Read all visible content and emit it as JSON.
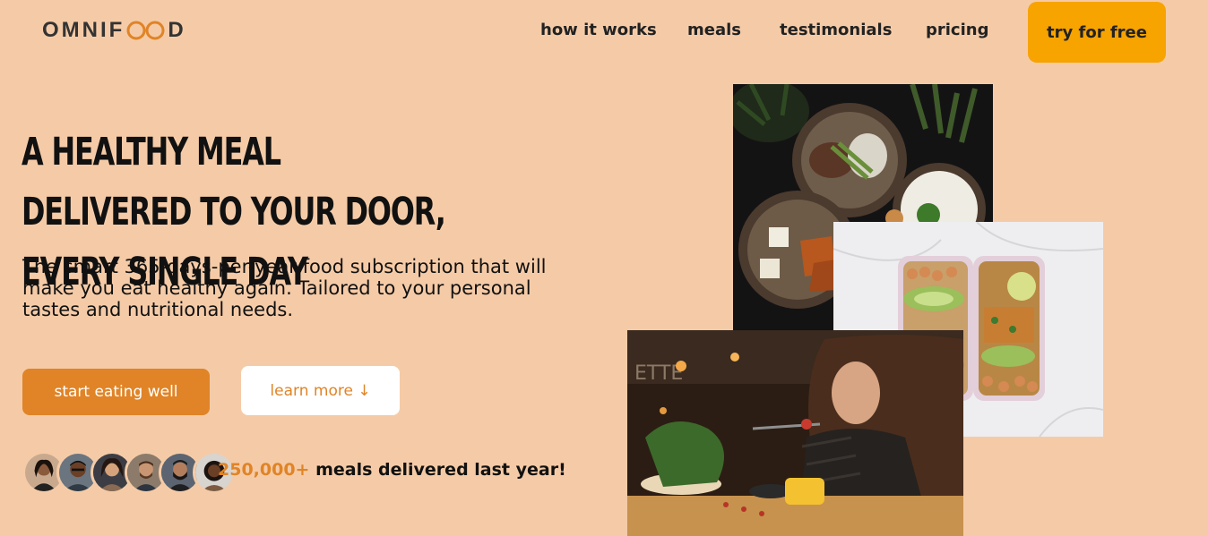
{
  "brand": {
    "logo_left": "OMNIF",
    "logo_right": "D"
  },
  "nav": {
    "links": [
      "how it works",
      "meals",
      "testimonials",
      "pricing"
    ],
    "cta": "try for free"
  },
  "hero": {
    "headline": "A healthy meal delivered to your door, every single day",
    "subtext": "The smart 365-days-per-year food subscription that will make you eat healthy again. Tailored to your personal tastes and nutritional needs.",
    "primary_button": "start eating well",
    "secondary_button": "learn more ↓",
    "delivered_count": "250,000+",
    "delivered_text": " meals delivered last year!"
  },
  "colors": {
    "background": "#f5cba7",
    "accent": "#e08427",
    "cta": "#f7a300"
  }
}
